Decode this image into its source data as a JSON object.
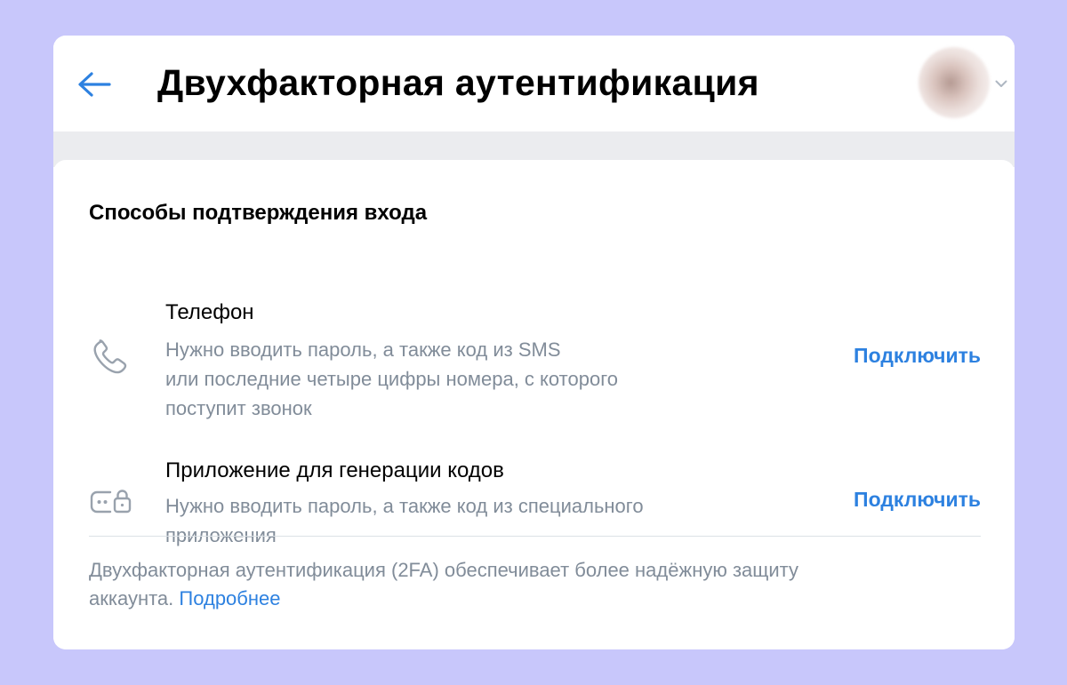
{
  "header": {
    "title": "Двухфакторная аутентификация",
    "back_icon": "arrow-left-icon",
    "avatar_icon": "user-avatar",
    "dropdown_icon": "chevron-down-icon"
  },
  "section": {
    "title": "Способы подтверждения входа"
  },
  "methods": [
    {
      "icon": "phone-icon",
      "title": "Телефон",
      "desc_lines": [
        "Нужно вводить пароль, а также код из SMS",
        "или последние четыре цифры номера, с которого",
        "поступит звонок"
      ],
      "action": "Подключить"
    },
    {
      "icon": "code-generator-lock-icon",
      "title": "Приложение для генерации кодов",
      "desc_lines": [
        "Нужно вводить пароль, а также код из специального",
        "приложения"
      ],
      "action": "Подключить"
    }
  ],
  "footer": {
    "line1": "Двухфакторная аутентификация (2FA) обеспечивает более надёжную защиту",
    "line2_text": "аккаунта.",
    "link": "Подробнее"
  },
  "colors": {
    "background": "#c8c7fb",
    "accent": "#2d81e0",
    "secondary_text": "#818c99",
    "band": "#ebecef"
  }
}
